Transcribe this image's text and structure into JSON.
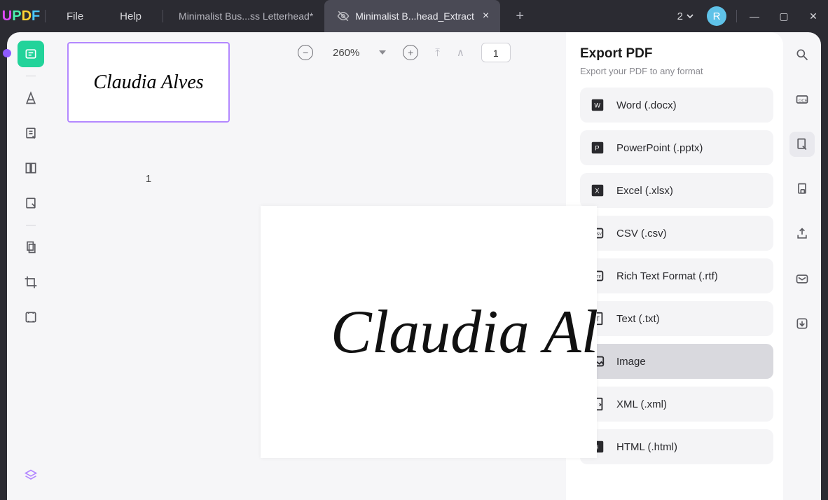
{
  "title_bar": {
    "menu": {
      "file": "File",
      "help": "Help"
    },
    "tabs": [
      {
        "label": "Minimalist Bus...ss Letterhead*",
        "active": false
      },
      {
        "label": "Minimalist B...head_Extract",
        "active": true
      }
    ],
    "doc_count": "2",
    "avatar_letter": "R"
  },
  "toolbar": {
    "zoom_pct": "260%",
    "page_current": "1"
  },
  "thumbnails": {
    "page1_num": "1",
    "page1_text": "Claudia Alves"
  },
  "document": {
    "main_text": "Claudia Alves"
  },
  "export_panel": {
    "title": "Export PDF",
    "subtitle": "Export your PDF to any format",
    "items": [
      {
        "label": "Word (.docx)",
        "icon": "word"
      },
      {
        "label": "PowerPoint (.pptx)",
        "icon": "ppt"
      },
      {
        "label": "Excel (.xlsx)",
        "icon": "xls"
      },
      {
        "label": "CSV (.csv)",
        "icon": "csv"
      },
      {
        "label": "Rich Text Format (.rtf)",
        "icon": "rtf"
      },
      {
        "label": "Text (.txt)",
        "icon": "txt"
      },
      {
        "label": "Image",
        "icon": "img",
        "hover": true
      },
      {
        "label": "XML (.xml)",
        "icon": "xml"
      },
      {
        "label": "HTML (.html)",
        "icon": "html"
      }
    ]
  }
}
